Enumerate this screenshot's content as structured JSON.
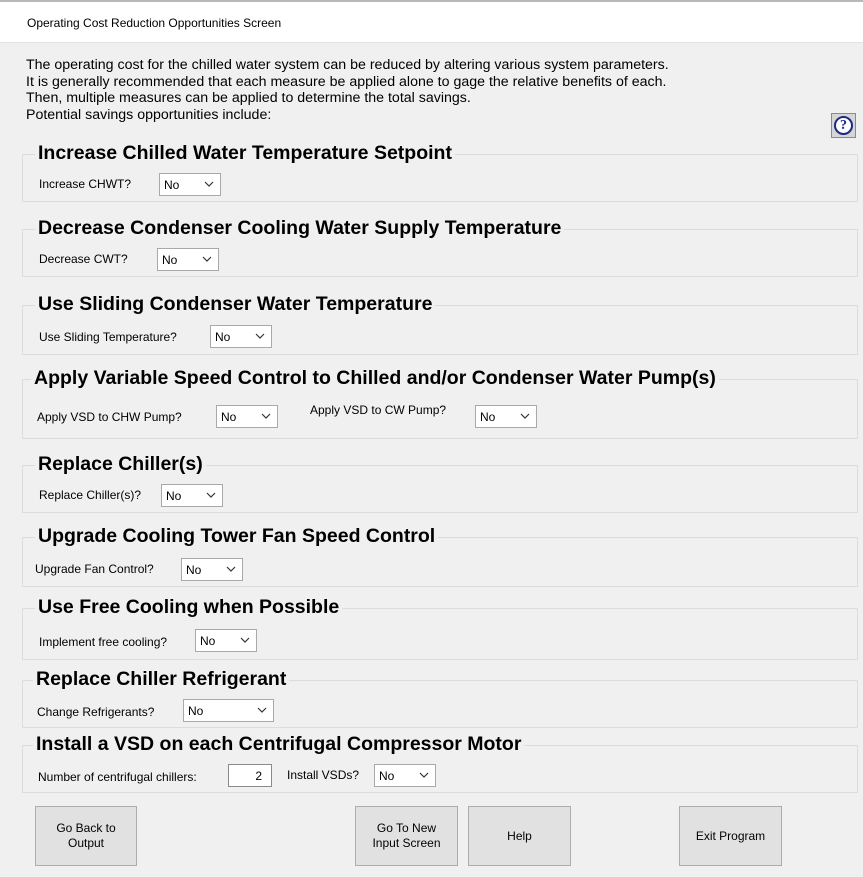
{
  "window": {
    "title": "Operating Cost Reduction Opportunities Screen"
  },
  "intro": {
    "lines": [
      "The operating cost for the chilled water system can be reduced by altering various system parameters.",
      " It is generally recommended that each measure be applied alone to gage the relative benefits of each.",
      "Then, multiple measures can be applied to determine the total savings.",
      " Potential savings opportunities include:"
    ]
  },
  "groups": {
    "chwt": {
      "title": "Increase Chilled Water Temperature Setpoint",
      "label": "Increase CHWT?",
      "value": "No"
    },
    "cwt": {
      "title": "Decrease Condenser Cooling Water Supply Temperature",
      "label": "Decrease CWT?",
      "value": "No"
    },
    "sliding": {
      "title": "Use Sliding Condenser Water Temperature",
      "label": "Use Sliding Temperature?",
      "value": "No"
    },
    "vsd_pumps": {
      "title": "Apply Variable Speed Control to Chilled and/or Condenser Water Pump(s)",
      "chw_label": "Apply VSD to CHW Pump?",
      "chw_value": "No",
      "cw_label": "Apply VSD to CW Pump?",
      "cw_value": "No"
    },
    "chiller": {
      "title": "Replace Chiller(s)",
      "label": "Replace Chiller(s)?",
      "value": "No"
    },
    "tower": {
      "title": "Upgrade Cooling Tower Fan Speed Control",
      "label": "Upgrade Fan Control?",
      "value": "No"
    },
    "free_cooling": {
      "title": "Use Free Cooling when Possible",
      "label": "Implement free cooling?",
      "value": "No"
    },
    "refrigerant": {
      "title": "Replace Chiller Refrigerant",
      "label": "Change Refrigerants?",
      "value": "No"
    },
    "compressor_vsd": {
      "title": "Install a VSD on each Centrifugal Compressor Motor",
      "count_label": "Number of centrifugal chillers:",
      "count_value": "2",
      "install_label": "Install VSDs?",
      "install_value": "No"
    }
  },
  "buttons": {
    "back": "Go Back to\nOutput",
    "new_input": "Go To New\nInput Screen",
    "help": "Help",
    "exit": "Exit Program"
  },
  "icons": {
    "help": "question-mark-icon",
    "dropdown": "chevron-down-icon"
  }
}
